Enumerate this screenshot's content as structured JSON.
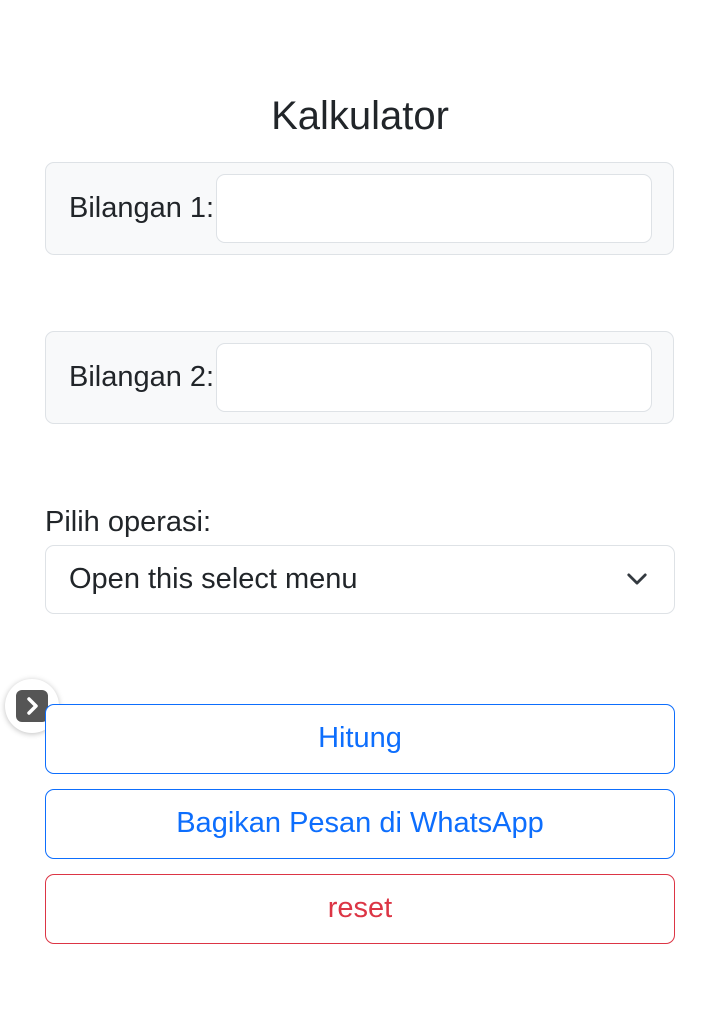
{
  "page": {
    "title": "Kalkulator"
  },
  "form": {
    "bilangan1": {
      "label": "Bilangan 1:",
      "value": "",
      "placeholder": ""
    },
    "bilangan2": {
      "label": "Bilangan 2:",
      "value": "",
      "placeholder": ""
    },
    "operation": {
      "label": "Pilih operasi:",
      "selected": "Open this select menu",
      "icon": "chevron-down-icon"
    }
  },
  "buttons": {
    "hitung": "Hitung",
    "share_whatsapp": "Bagikan Pesan di WhatsApp",
    "reset": "reset"
  },
  "side_toggle": {
    "icon": "chevron-right-icon"
  },
  "colors": {
    "primary": "#0d6efd",
    "danger": "#dc3545",
    "text": "#212529",
    "group_bg": "#f8f9fa",
    "border": "#dee2e6"
  }
}
